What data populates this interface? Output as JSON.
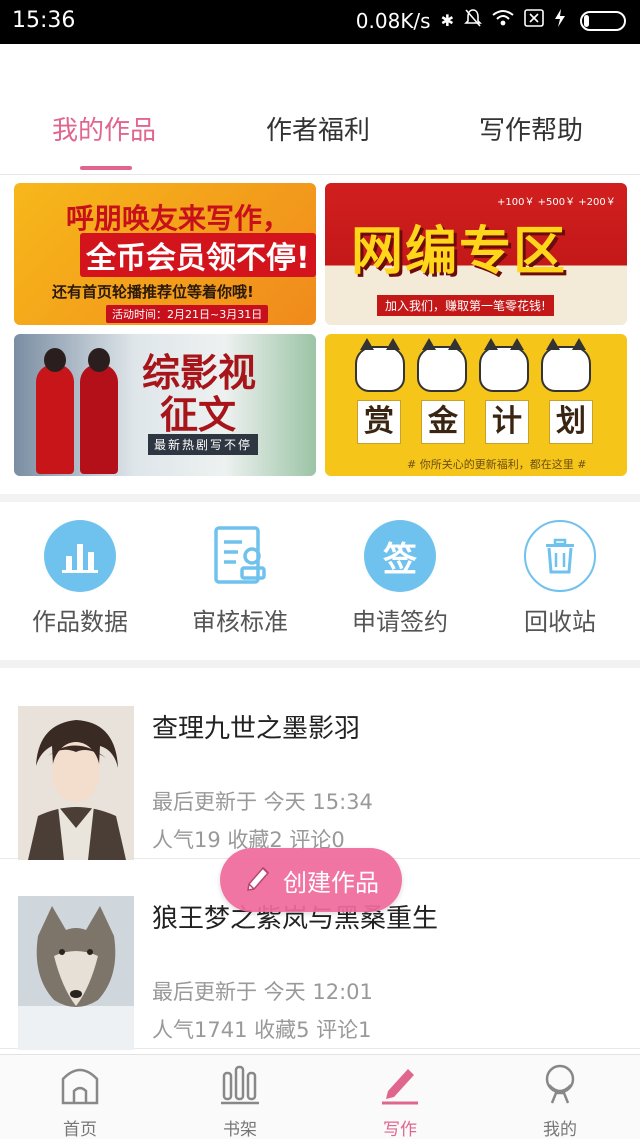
{
  "status_bar": {
    "time": "15:36",
    "network_speed": "0.08K/s",
    "icons": [
      "bluetooth-icon",
      "mute-icon",
      "wifi-icon",
      "sim-icon",
      "charging-icon",
      "battery-icon"
    ],
    "battery_level": 0.15
  },
  "tabs": [
    {
      "label": "我的作品",
      "active": true
    },
    {
      "label": "作者福利",
      "active": false
    },
    {
      "label": "写作帮助",
      "active": false
    }
  ],
  "banners": {
    "b1": {
      "headline": "呼朋唤友来写作，",
      "highlight": "全币会员领不停!",
      "line": "还有首页轮播推荐位等着你哦!",
      "period": "活动时间：2月21日~3月31日"
    },
    "b2": {
      "headline": "网编专区",
      "subline": "加入我们，赚取第一笔零花钱!",
      "tags": "+100￥ +500￥ +200￥"
    },
    "b3": {
      "headline_1": "综影视",
      "headline_2": "征文",
      "subline": "最新热剧写不停"
    },
    "b4": {
      "chars": [
        "赏",
        "金",
        "计",
        "划"
      ],
      "subline": "# 你所关心的更新福利，都在这里 #"
    }
  },
  "tools": [
    {
      "label": "作品数据",
      "icon": "bar-chart-icon"
    },
    {
      "label": "审核标准",
      "icon": "document-review-icon"
    },
    {
      "label": "申请签约",
      "icon": "sign-contract-icon",
      "icon_text": "签"
    },
    {
      "label": "回收站",
      "icon": "trash-icon"
    }
  ],
  "works": [
    {
      "title": "查理九世之墨影羽",
      "updated": "最后更新于 今天 15:34",
      "stats": "人气19  收藏2  评论0"
    },
    {
      "title": "狼王梦之紫岚与黑桑重生",
      "updated": "最后更新于 今天 12:01",
      "stats": "人气1741  收藏5  评论1"
    }
  ],
  "fab": {
    "label": "创建作品",
    "icon": "pencil-icon"
  },
  "bottom_nav": [
    {
      "label": "首页",
      "icon": "home-icon",
      "active": false
    },
    {
      "label": "书架",
      "icon": "bookshelf-icon",
      "active": false
    },
    {
      "label": "写作",
      "icon": "pen-icon",
      "active": true
    },
    {
      "label": "我的",
      "icon": "profile-icon",
      "active": false
    }
  ],
  "colors": {
    "accent": "#e0668e",
    "fab": "#f06b9d",
    "tool_blue": "#6fc2ee",
    "text_primary": "#222222",
    "text_secondary": "#999999"
  }
}
